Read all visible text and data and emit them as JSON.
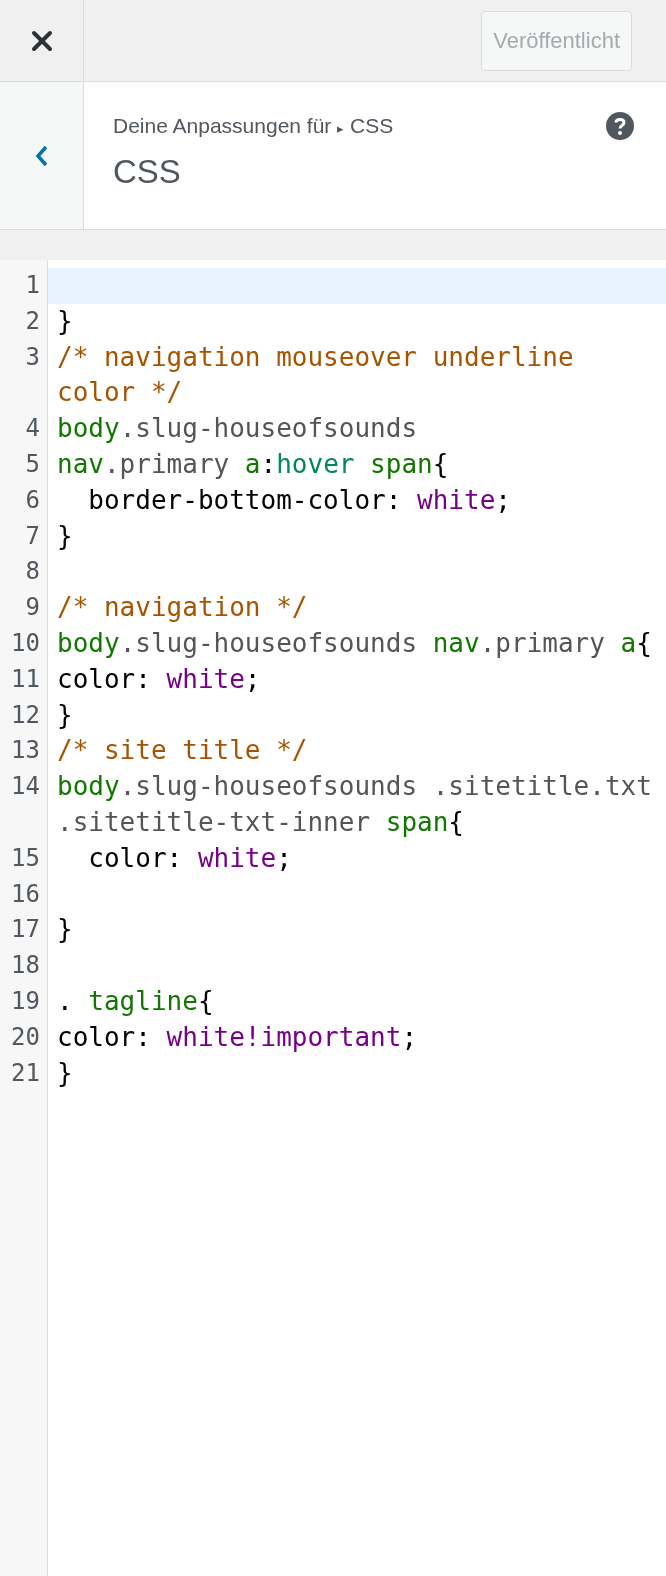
{
  "topbar": {
    "publish_button": {
      "label": "Veröffentlicht",
      "disabled": true
    }
  },
  "header": {
    "breadcrumb": {
      "prefix": "Deine Anpassungen für",
      "separator": "▸",
      "current": "CSS"
    },
    "title": "CSS"
  },
  "editor": {
    "lines": [
      {
        "number": "1",
        "active": true
      },
      {
        "number": "2",
        "active": false,
        "tokens": [
          {
            "kind": "punct",
            "text": "}"
          }
        ]
      },
      {
        "number": "3",
        "active": false,
        "tokens": [
          {
            "kind": "comment",
            "text": "/* navigation mouseover underline color */"
          }
        ]
      },
      {
        "number": "4",
        "active": false,
        "tokens": [
          {
            "kind": "tag",
            "text": "body"
          },
          {
            "kind": "plain",
            "text": ".slug-houseofsounds"
          }
        ]
      },
      {
        "number": "5",
        "active": false,
        "tokens": [
          {
            "kind": "tag",
            "text": "nav"
          },
          {
            "kind": "plain",
            "text": ".primary "
          },
          {
            "kind": "tag",
            "text": "a"
          },
          {
            "kind": "punct",
            "text": ":"
          },
          {
            "kind": "keyword",
            "text": "hover"
          },
          {
            "kind": "tag",
            "text": " span"
          },
          {
            "kind": "punct",
            "text": "{"
          }
        ]
      },
      {
        "number": "6",
        "active": false,
        "tokens": [
          {
            "kind": "punct",
            "text": "  border-bottom-color: "
          },
          {
            "kind": "value",
            "text": "white"
          },
          {
            "kind": "punct",
            "text": ";"
          }
        ]
      },
      {
        "number": "7",
        "active": false,
        "tokens": [
          {
            "kind": "punct",
            "text": "}"
          }
        ]
      },
      {
        "number": "8",
        "active": false
      },
      {
        "number": "9",
        "active": false,
        "tokens": [
          {
            "kind": "comment",
            "text": "/* navigation */"
          }
        ]
      },
      {
        "number": "10",
        "active": false,
        "tokens": [
          {
            "kind": "tag",
            "text": "body"
          },
          {
            "kind": "plain",
            "text": ".slug-houseofsounds "
          },
          {
            "kind": "tag",
            "text": "nav"
          },
          {
            "kind": "plain",
            "text": ".primary "
          },
          {
            "kind": "tag",
            "text": "a"
          },
          {
            "kind": "punct",
            "text": "{"
          }
        ]
      },
      {
        "number": "11",
        "active": false,
        "tokens": [
          {
            "kind": "punct",
            "text": "color: "
          },
          {
            "kind": "value",
            "text": "white"
          },
          {
            "kind": "punct",
            "text": ";"
          }
        ]
      },
      {
        "number": "12",
        "active": false,
        "tokens": [
          {
            "kind": "punct",
            "text": "}"
          }
        ]
      },
      {
        "number": "13",
        "active": false,
        "tokens": [
          {
            "kind": "comment",
            "text": "/* site title */"
          }
        ]
      },
      {
        "number": "14",
        "active": false,
        "tokens": [
          {
            "kind": "tag",
            "text": "body"
          },
          {
            "kind": "plain",
            "text": ".slug-houseofsounds .sitetitle.txt .sitetitle-txt-inner "
          },
          {
            "kind": "tag",
            "text": "span"
          },
          {
            "kind": "punct",
            "text": "{"
          }
        ]
      },
      {
        "number": "15",
        "active": false,
        "tokens": [
          {
            "kind": "punct",
            "text": "  color: "
          },
          {
            "kind": "value",
            "text": "white"
          },
          {
            "kind": "punct",
            "text": ";"
          }
        ]
      },
      {
        "number": "16",
        "active": false
      },
      {
        "number": "17",
        "active": false,
        "tokens": [
          {
            "kind": "punct",
            "text": "}"
          }
        ]
      },
      {
        "number": "18",
        "active": false
      },
      {
        "number": "19",
        "active": false,
        "tokens": [
          {
            "kind": "punct",
            "text": ". "
          },
          {
            "kind": "tag",
            "text": "tagline"
          },
          {
            "kind": "punct",
            "text": "{"
          }
        ]
      },
      {
        "number": "20",
        "active": false,
        "tokens": [
          {
            "kind": "punct",
            "text": "color: "
          },
          {
            "kind": "value",
            "text": "white!important"
          },
          {
            "kind": "punct",
            "text": ";"
          }
        ]
      },
      {
        "number": "21",
        "active": false,
        "tokens": [
          {
            "kind": "punct",
            "text": "}"
          }
        ]
      }
    ]
  }
}
